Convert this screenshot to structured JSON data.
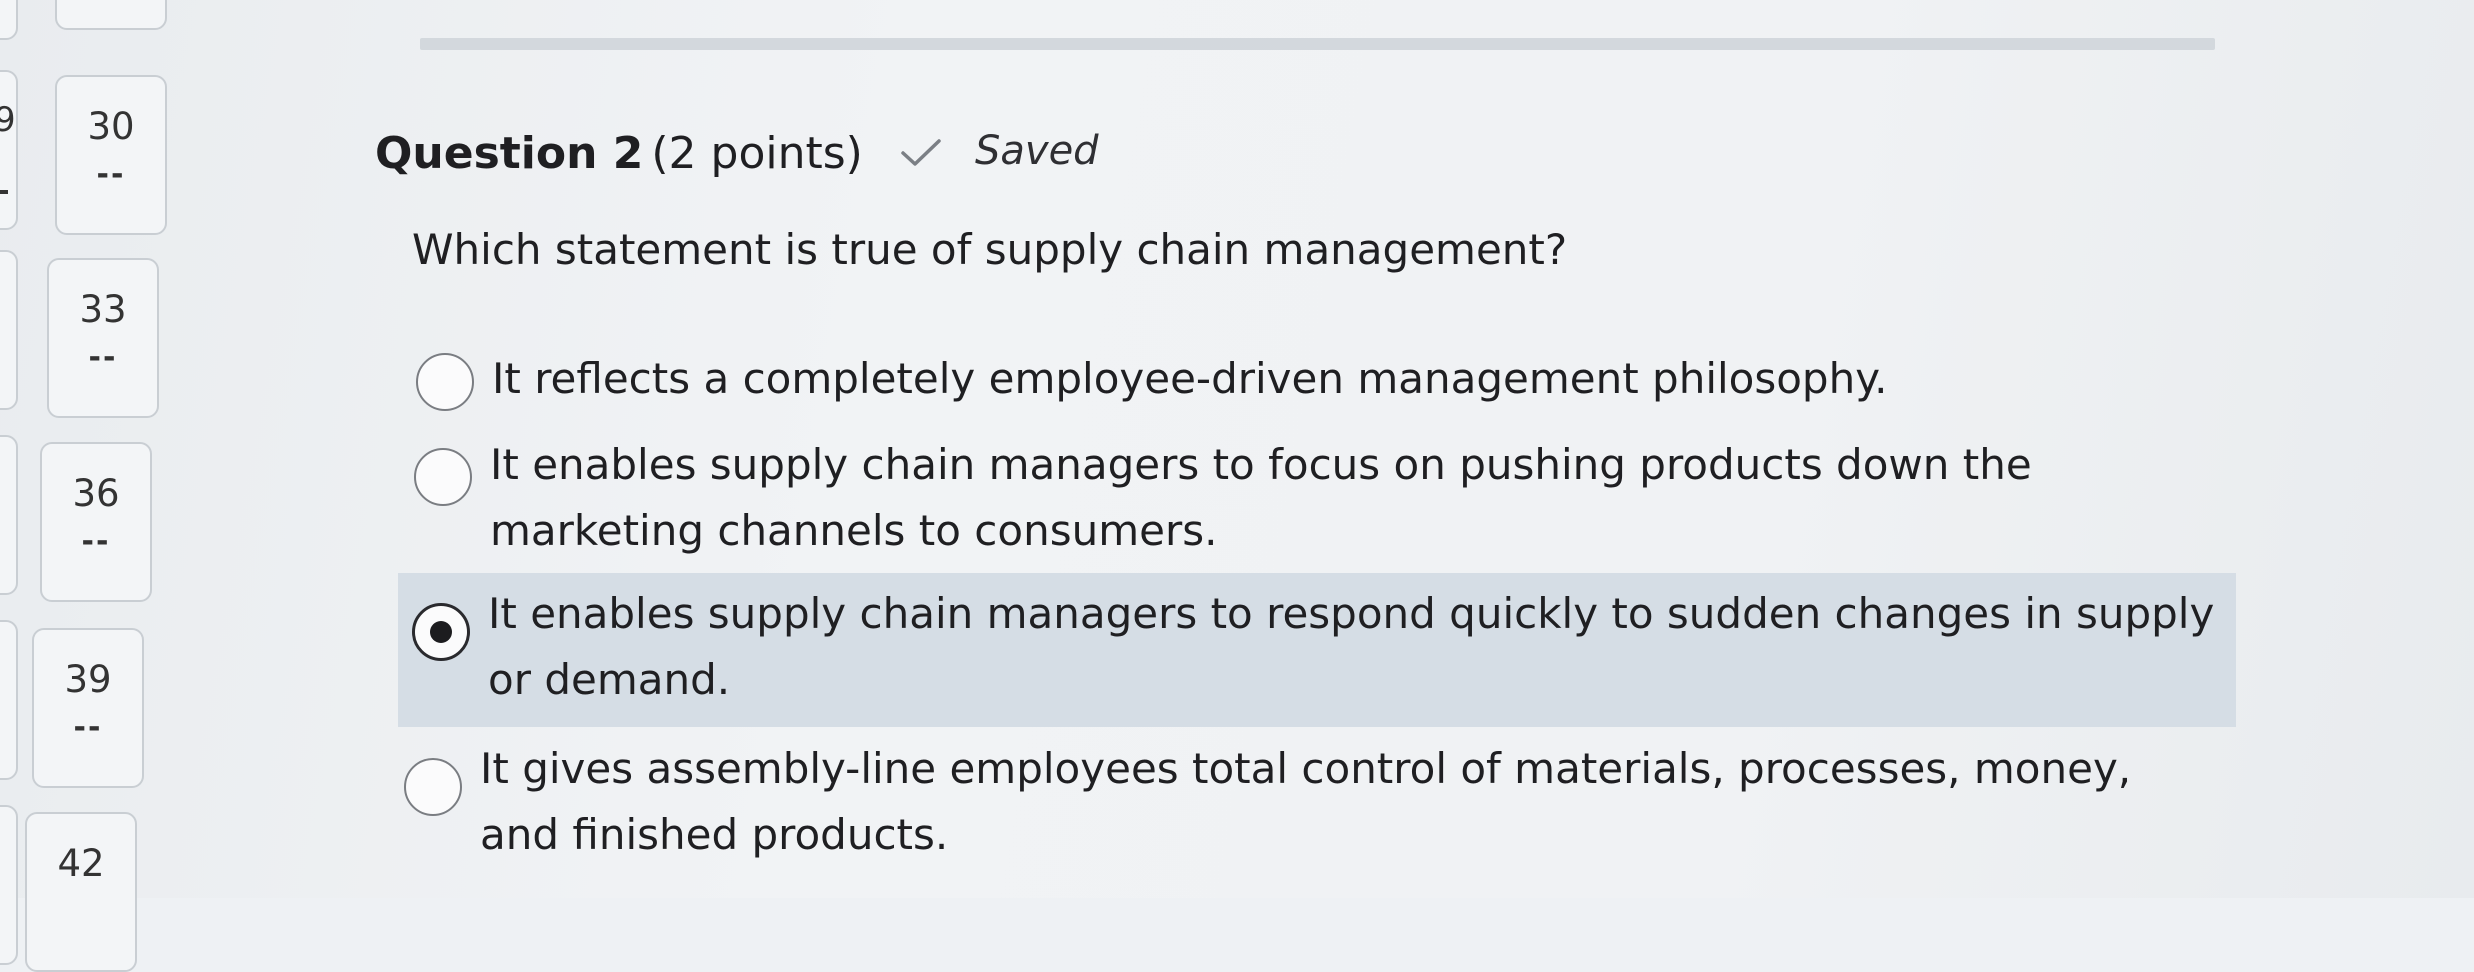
{
  "nav": {
    "tiles": [
      {
        "number": "30",
        "status": "--"
      },
      {
        "number": "33",
        "status": "--"
      },
      {
        "number": "36",
        "status": "--"
      },
      {
        "number": "39",
        "status": "--"
      },
      {
        "number": "42",
        "status": ""
      }
    ],
    "partial_left_number": "9"
  },
  "question": {
    "title": "Question 2",
    "points": "(2 points)",
    "status_icon": "check-icon",
    "status_label": "Saved",
    "prompt": "Which statement is true of supply chain management?"
  },
  "options": [
    {
      "text": "It reflects a completely employee-driven management philosophy.",
      "selected": false
    },
    {
      "text": "It enables supply chain managers to focus on pushing products down the marketing channels to consumers.",
      "selected": false
    },
    {
      "text": "It enables supply chain managers to respond quickly to sudden changes in supply or demand.",
      "selected": true
    },
    {
      "text": "It gives assembly-line employees total control of materials, processes, money, and finished products.",
      "selected": false
    }
  ],
  "colors": {
    "selected_background": "#d5dde5",
    "page_background": "#eef1f4"
  }
}
